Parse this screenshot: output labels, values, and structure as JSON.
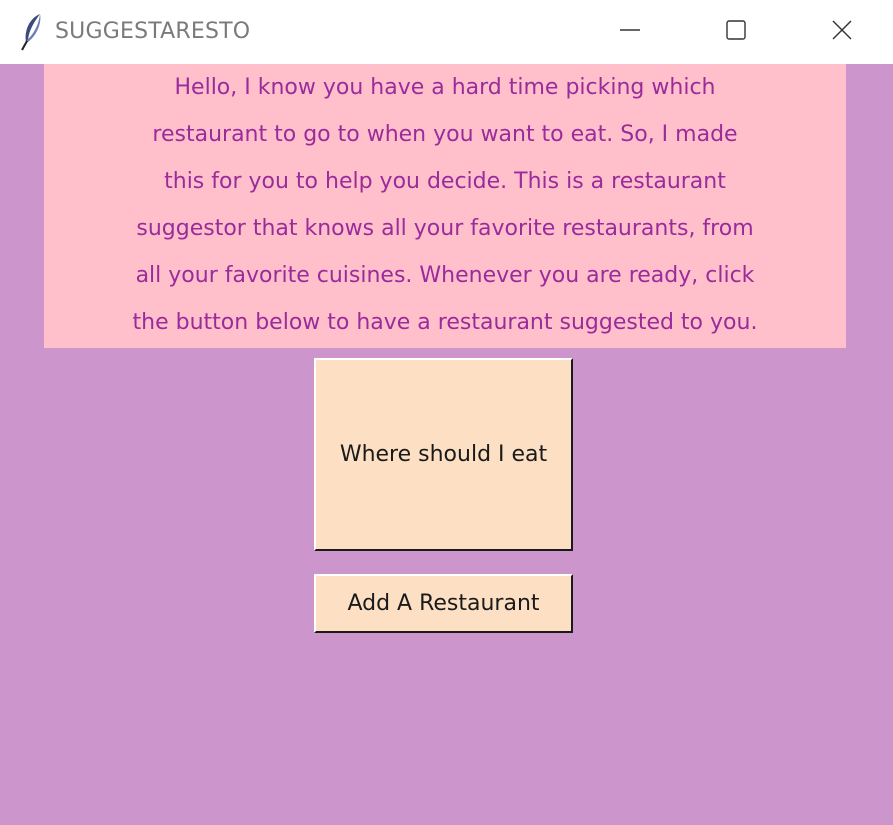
{
  "window": {
    "title": "SUGGESTARESTO",
    "icon": "feather-icon",
    "controls": [
      "minimize-icon",
      "maximize-icon",
      "close-icon"
    ]
  },
  "message": {
    "lines": [
      "Hello, I know you have a hard time picking which",
      "restaurant to go to when you want to eat. So, I made",
      "this for you to help you decide. This is a restaurant",
      "suggestor that knows all your favorite restaurants, from",
      "all your favorite cuisines. Whenever you are ready, click",
      "the button below to have a restaurant suggested to you."
    ]
  },
  "buttons": {
    "eat_label": "Where should I eat",
    "add_label": "Add A Restaurant"
  },
  "colors": {
    "window_bg": "#cc95cc",
    "panel_bg": "#ffc0cb",
    "panel_text": "#9b2b9b",
    "button_bg": "#fde0c4"
  }
}
